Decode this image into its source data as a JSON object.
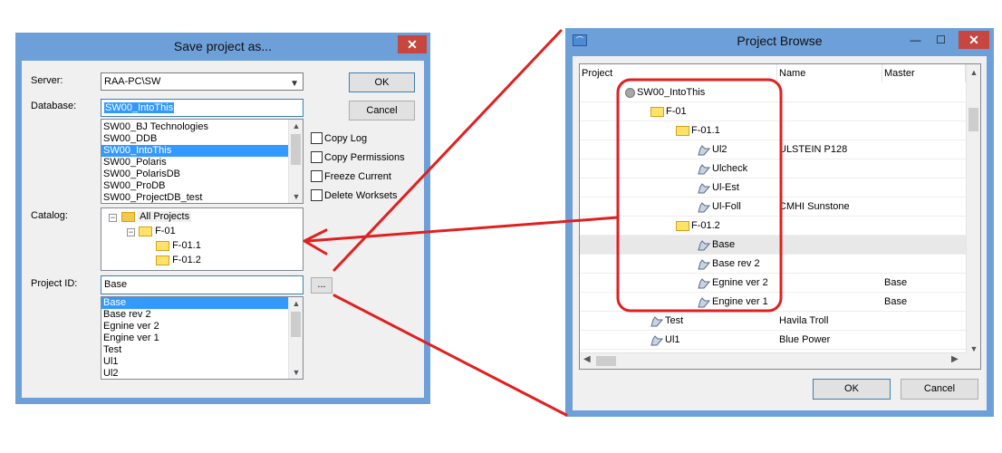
{
  "save_dialog": {
    "title": "Save project as...",
    "close_glyph": "✕",
    "server_label": "Server:",
    "server_value": "RAA-PC\\SW",
    "database_label": "Database:",
    "database_value": "SW00_IntoThis",
    "database_options": [
      "SW00_BJ Technologies",
      "SW00_DDB",
      "SW00_IntoThis",
      "SW00_Polaris",
      "SW00_PolarisDB",
      "SW00_ProDB",
      "SW00_ProjectDB_test"
    ],
    "database_selected_index": 2,
    "catalog_label": "Catalog:",
    "catalog_tree": {
      "root": "All Projects",
      "f01": "F-01",
      "f011": "F-01.1",
      "f012": "F-01.2"
    },
    "project_id_label": "Project ID:",
    "project_id_value": "Base",
    "browse_label": "...",
    "project_options": [
      "Base",
      "Base rev 2",
      "Egnine ver 2",
      "Engine ver 1",
      "Test",
      "Ul1",
      "Ul2"
    ],
    "project_selected_index": 0,
    "ok_label": "OK",
    "cancel_label": "Cancel",
    "options": [
      "Copy Log",
      "Copy Permissions",
      "Freeze Current",
      "Delete Worksets"
    ]
  },
  "browse_dialog": {
    "title": "Project Browse",
    "min_glyph": "—",
    "max_glyph": "☐",
    "close_glyph": "✕",
    "columns": [
      "Project",
      "Name",
      "Master"
    ],
    "rows": [
      {
        "type": "db",
        "level": 0,
        "project": "SW00_IntoThis",
        "name": "",
        "master": ""
      },
      {
        "type": "folder",
        "level": 1,
        "project": "F-01",
        "name": "",
        "master": ""
      },
      {
        "type": "folder",
        "level": 2,
        "project": "F-01.1",
        "name": "",
        "master": ""
      },
      {
        "type": "project",
        "level": 3,
        "project": "Ul2",
        "name": "ULSTEIN P128",
        "master": ""
      },
      {
        "type": "project",
        "level": 3,
        "project": "Ulcheck",
        "name": "",
        "master": ""
      },
      {
        "type": "project",
        "level": 3,
        "project": "Ul-Est",
        "name": "",
        "master": ""
      },
      {
        "type": "project",
        "level": 3,
        "project": "Ul-Foll",
        "name": "CMHI Sunstone",
        "master": ""
      },
      {
        "type": "folder",
        "level": 2,
        "project": "F-01.2",
        "name": "",
        "master": ""
      },
      {
        "type": "project",
        "level": 3,
        "project": "Base",
        "name": "",
        "master": "",
        "highlighted": true
      },
      {
        "type": "project",
        "level": 3,
        "project": "Base rev 2",
        "name": "",
        "master": ""
      },
      {
        "type": "project",
        "level": 3,
        "project": "Egnine ver 2",
        "name": "",
        "master": "Base"
      },
      {
        "type": "project",
        "level": 3,
        "project": "Engine ver 1",
        "name": "",
        "master": "Base"
      },
      {
        "type": "project",
        "level": 1,
        "project": "Test",
        "name": "Havila Troll",
        "master": ""
      },
      {
        "type": "project",
        "level": 1,
        "project": "Ul1",
        "name": "Blue Power",
        "master": ""
      }
    ],
    "ok_label": "OK",
    "cancel_label": "Cancel"
  },
  "annotation": {
    "color": "#e02020"
  }
}
